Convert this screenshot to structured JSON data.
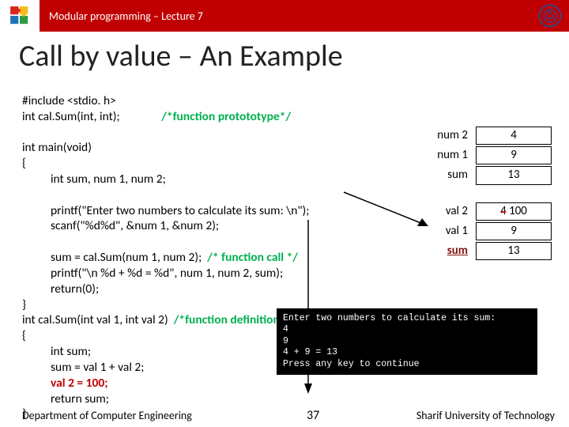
{
  "header": {
    "course": "Modular programming – Lecture 7"
  },
  "title": "Call by value – An Example",
  "code": {
    "l1": "#include <stdio. h>",
    "l2a": "int cal.Sum(int, int);",
    "l2b": "/*function protototype*/",
    "l3": "int main(void)",
    "l4": "{",
    "l5": "int sum, num 1, num 2;",
    "l6": "printf(\"Enter two numbers to calculate its sum: \\n\");",
    "l7": "scanf(\"%d%d\", &num 1, &num 2);",
    "l8a": "sum = cal.Sum(num 1, num 2);",
    "l8b": "/* function call */",
    "l9": "printf(\"\\n %d + %d = %d\", num 1, num 2, sum);",
    "l10": "return(0);",
    "l11": "}",
    "l12a": "int cal.Sum(int val 1, int val 2)",
    "l12b": "/*function definition*/",
    "l13": "{",
    "l14": "int sum;",
    "l15": "sum = val 1 + val 2;",
    "l16": "val 2 = 100;",
    "l17": "return sum;",
    "l18": "}"
  },
  "memory": {
    "main": [
      {
        "label": "num 2",
        "val": "4"
      },
      {
        "label": "num 1",
        "val": "9"
      },
      {
        "label": "sum",
        "val": "13"
      }
    ],
    "func": [
      {
        "label": "val 2",
        "val_old": "4",
        "val_new": "100"
      },
      {
        "label": "val 1",
        "val": "9"
      },
      {
        "label": "sum",
        "val": "13"
      }
    ]
  },
  "output": "Enter two numbers to calculate its sum:\n4\n9\n4 + 9 = 13\nPress any key to continue",
  "footer": {
    "left": "Department of Computer Engineering",
    "page": "37",
    "right": "Sharif University of Technology"
  }
}
